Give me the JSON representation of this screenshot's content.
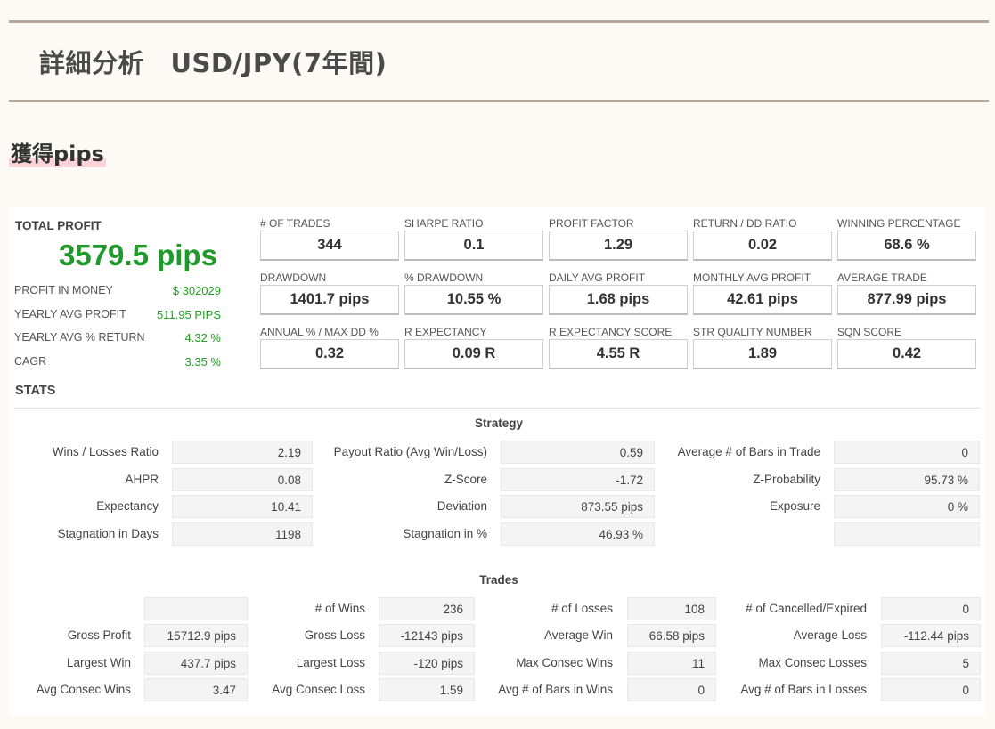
{
  "header": {
    "title": "詳細分析　USD/JPY(7年間)"
  },
  "section": {
    "title": "獲得pips"
  },
  "summary": {
    "total_profit_label": "TOTAL PROFIT",
    "total_profit_value": "3579.5 pips",
    "rows": [
      {
        "label": "PROFIT IN MONEY",
        "value": "$ 302029"
      },
      {
        "label": "YEARLY AVG PROFIT",
        "value": "511.95 PIPS"
      },
      {
        "label": "YEARLY AVG % RETURN",
        "value": "4.32 %"
      },
      {
        "label": "CAGR",
        "value": "3.35 %"
      }
    ]
  },
  "metrics": [
    {
      "label": "# OF TRADES",
      "value": "344"
    },
    {
      "label": "SHARPE RATIO",
      "value": "0.1"
    },
    {
      "label": "PROFIT FACTOR",
      "value": "1.29"
    },
    {
      "label": "RETURN / DD RATIO",
      "value": "0.02"
    },
    {
      "label": "WINNING PERCENTAGE",
      "value": "68.6 %"
    },
    {
      "label": "DRAWDOWN",
      "value": "1401.7 pips"
    },
    {
      "label": "% DRAWDOWN",
      "value": "10.55 %"
    },
    {
      "label": "DAILY AVG PROFIT",
      "value": "1.68 pips"
    },
    {
      "label": "MONTHLY AVG PROFIT",
      "value": "42.61 pips"
    },
    {
      "label": "AVERAGE TRADE",
      "value": "877.99 pips"
    },
    {
      "label": "ANNUAL % / MAX DD %",
      "value": "0.32"
    },
    {
      "label": "R EXPECTANCY",
      "value": "0.09 R"
    },
    {
      "label": "R EXPECTANCY SCORE",
      "value": "4.55 R"
    },
    {
      "label": "STR QUALITY NUMBER",
      "value": "1.89"
    },
    {
      "label": "SQN SCORE",
      "value": "0.42"
    }
  ],
  "stats": {
    "title": "STATS",
    "strategy": {
      "title": "Strategy",
      "rows": [
        [
          {
            "label": "Wins / Losses Ratio",
            "value": "2.19"
          },
          {
            "label": "Payout Ratio (Avg Win/Loss)",
            "value": "0.59"
          },
          {
            "label": "Average # of Bars in Trade",
            "value": "0"
          }
        ],
        [
          {
            "label": "AHPR",
            "value": "0.08"
          },
          {
            "label": "Z-Score",
            "value": "-1.72"
          },
          {
            "label": "Z-Probability",
            "value": "95.73 %"
          }
        ],
        [
          {
            "label": "Expectancy",
            "value": "10.41"
          },
          {
            "label": "Deviation",
            "value": "873.55 pips"
          },
          {
            "label": "Exposure",
            "value": "0 %"
          }
        ],
        [
          {
            "label": "Stagnation in Days",
            "value": "1198"
          },
          {
            "label": "Stagnation in %",
            "value": "46.93 %"
          },
          {
            "label": "",
            "value": ""
          }
        ]
      ]
    },
    "trades": {
      "title": "Trades",
      "rows": [
        [
          {
            "label": "",
            "value": ""
          },
          {
            "label": "# of Wins",
            "value": "236"
          },
          {
            "label": "# of Losses",
            "value": "108"
          },
          {
            "label": "# of Cancelled/Expired",
            "value": "0"
          }
        ],
        [
          {
            "label": "Gross Profit",
            "value": "15712.9 pips"
          },
          {
            "label": "Gross Loss",
            "value": "-12143 pips"
          },
          {
            "label": "Average Win",
            "value": "66.58 pips"
          },
          {
            "label": "Average Loss",
            "value": "-112.44 pips"
          }
        ],
        [
          {
            "label": "Largest Win",
            "value": "437.7 pips"
          },
          {
            "label": "Largest Loss",
            "value": "-120 pips"
          },
          {
            "label": "Max Consec Wins",
            "value": "11"
          },
          {
            "label": "Max Consec Losses",
            "value": "5"
          }
        ],
        [
          {
            "label": "Avg Consec Wins",
            "value": "3.47"
          },
          {
            "label": "Avg Consec Loss",
            "value": "1.59"
          },
          {
            "label": "Avg # of Bars in Wins",
            "value": "0"
          },
          {
            "label": "Avg # of Bars in Losses",
            "value": "0"
          }
        ]
      ]
    }
  }
}
